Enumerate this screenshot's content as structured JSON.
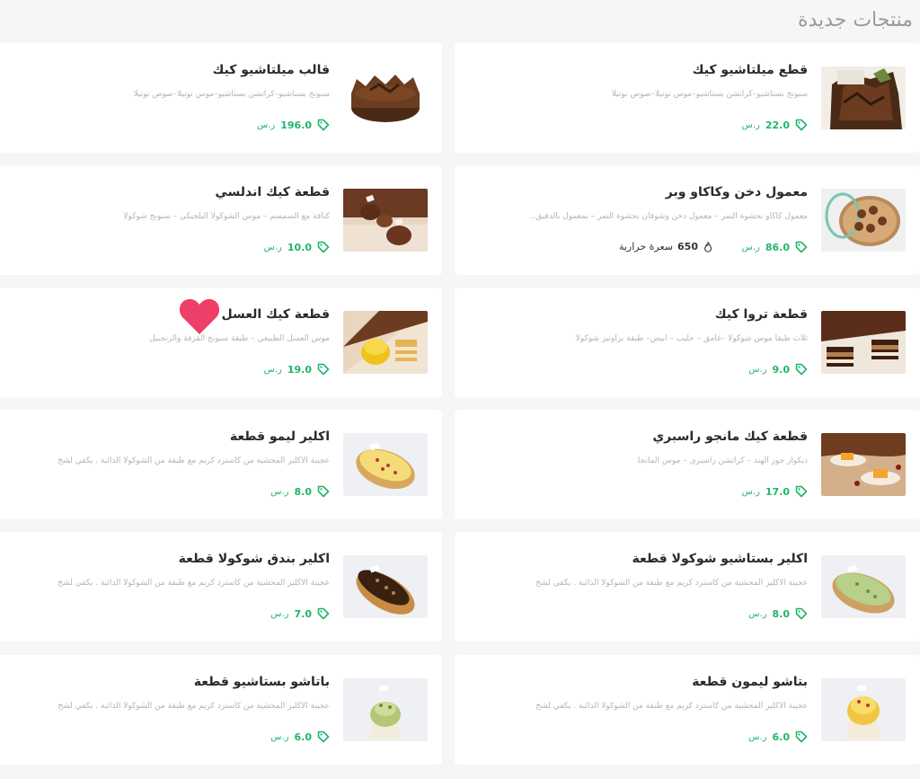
{
  "section": {
    "title": "منتجات جديدة"
  },
  "currency": "ر.س",
  "calories_label": "سعرة حرارية",
  "products": [
    {
      "name": "قطع ميلتاشيو كيك",
      "desc": "سبونج بستاشيو–كراتشن بستاشيو–موس نوتيلا–صوص نوتيلا",
      "price": "22.0",
      "thumb": "cake-dark"
    },
    {
      "name": "قالب ميلتاشيو كيك",
      "desc": "سبونج بستاشيو–كراتشن بستاشيو–موس نوتيلا–صوص نوتيلا",
      "price": "196.0",
      "thumb": "cake-whole"
    },
    {
      "name": "معمول دخن وكاكاو وبر",
      "desc": "معمول كاكاو بحشوة التمر – معمول دخن وشوفان بحشوة التمر – بمعمول بالدقيق..",
      "price": "86.0",
      "calories": "650",
      "thumb": "box"
    },
    {
      "name": "قطعة كيك اندلسي",
      "desc": "كنافة مع السمسم – موس الشوكولا البلجيكي – سبونج شوكولا",
      "price": "10.0",
      "thumb": "brown-domes"
    },
    {
      "name": "قطعة تروا كيك",
      "desc": "ثلاث طبقا موس شوكولا –غامق – حليب – ابيض– طبقة براونيز شوكولا",
      "price": "9.0",
      "thumb": "slice-layers"
    },
    {
      "name": "قطعة كيك العسل",
      "desc": "موس العسل الطبيعي – طبقة سبونج القرفة والزنجبيل",
      "price": "19.0",
      "thumb": "yellow-dome"
    },
    {
      "name": "قطعة كيك مانجو راسبري",
      "desc": "ديكواز جوز الهند – كراتشن راسبري – موس المانجا",
      "price": "17.0",
      "thumb": "mango-plates"
    },
    {
      "name": "اكلير ليمو قطعة",
      "desc": "عجينة الاكلير المحشية من كاسترد كريم مع طبقة من الشوكولا الذائبة . يكفي لشخ",
      "price": "8.0",
      "thumb": "eclair-yellow"
    },
    {
      "name": "اكلير بستاشيو شوكولا قطعة",
      "desc": "عجينة الاكلير المحشية من كاسترد كريم مع طبقة من الشوكولا الذائبة . يكفي لشخ",
      "price": "8.0",
      "thumb": "eclair-green"
    },
    {
      "name": "اكلير بندق شوكولا قطعة",
      "desc": "عجينة الاكلير المحشية من كاسترد كريم مع طبقة من الشوكولا الذائبة . يكفي لشخ",
      "price": "7.0",
      "thumb": "eclair-choc"
    },
    {
      "name": "بتاشو ليمون قطعة",
      "desc": "عجينة الاكلير المحشية من كاسترد كريم مع طبقة من الشوكولا الذائبة . يكفي لشخ",
      "price": "6.0",
      "thumb": "puff-yellow"
    },
    {
      "name": "باتاشو بستاشيو قطعة",
      "desc": "عجينة الاكلير المحشية من كاسترد كريم مع طبقة من الشوكولا الذائبة . يكفي لشخ",
      "price": "6.0",
      "thumb": "puff-green"
    }
  ],
  "colors": {
    "accent": "#1fb66a",
    "heart": "#ee3f68",
    "page_bg": "#f6f6f6"
  }
}
